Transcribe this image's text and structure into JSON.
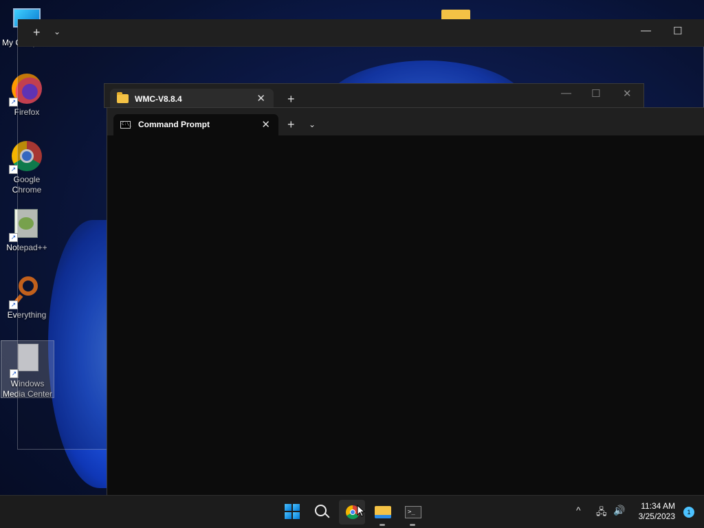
{
  "desktop": {
    "icons": [
      {
        "label": "My Computer"
      },
      {
        "label": "Firefox"
      },
      {
        "label": "Google Chrome"
      },
      {
        "label": "Notepad++"
      },
      {
        "label": "Everything"
      },
      {
        "label": "Windows Media Center"
      }
    ],
    "folder_label": "WMC-V8.8.4"
  },
  "terminal_back": {
    "new_tab": "+",
    "dropdown": "⌄",
    "minimize": "—",
    "maximize": "☐"
  },
  "explorer": {
    "tab_title": "WMC-V8.8.4",
    "close_tab": "✕",
    "new_tab": "+",
    "minimize": "—",
    "maximize": "☐",
    "close": "✕"
  },
  "terminal": {
    "tab_title": "Command Prompt",
    "tab_icon_text": "C:\\_",
    "close_tab": "✕",
    "new_tab": "+",
    "dropdown": "⌄"
  },
  "taskbar": {
    "time": "11:34 AM",
    "date": "3/25/2023",
    "notification_count": "1",
    "tray_chevron": "^"
  }
}
